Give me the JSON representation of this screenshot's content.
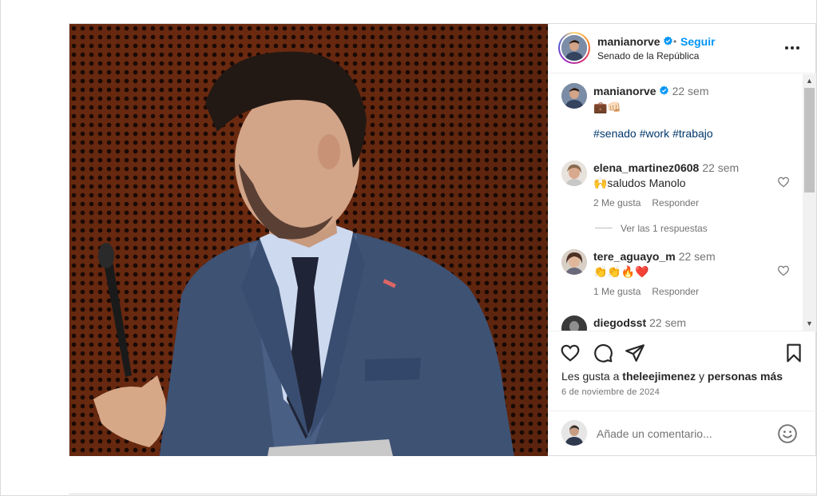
{
  "post": {
    "author": {
      "username": "manianorve",
      "verified": true,
      "follow_label": "Seguir",
      "separator": "•",
      "location": "Senado de la República"
    },
    "caption": {
      "username": "manianorve",
      "time": "22 sem",
      "emoji_line": "💼👊🏻",
      "hashtags": [
        "#senado",
        "#work",
        "#trabajo"
      ]
    },
    "comments": [
      {
        "username": "elena_martinez0608",
        "time": "22 sem",
        "text": "🙌saludos Manolo",
        "likes_label": "2 Me gusta",
        "reply_label": "Responder",
        "replies_label": "Ver las 1 respuestas"
      },
      {
        "username": "tere_aguayo_m",
        "time": "22 sem",
        "text": "👏👏🔥❤️",
        "likes_label": "1 Me gusta",
        "reply_label": "Responder"
      },
      {
        "username": "diegodsst",
        "time": "22 sem"
      }
    ],
    "likes": {
      "prefix": "Les gusta a",
      "user": "theleejimenez",
      "joiner": "y",
      "others": "personas más"
    },
    "date": "6 de noviembre de 2024",
    "add_comment": {
      "placeholder": "Añade un comentario..."
    },
    "icons": {
      "like": "heart-icon",
      "comment": "comment-icon",
      "share": "share-icon",
      "save": "bookmark-icon",
      "more": "more-icon",
      "emoji": "emoji-icon",
      "verified": "verified-badge-icon"
    },
    "colors": {
      "link": "#0095f6",
      "hashtag": "#00376b",
      "secondary_text": "#737373",
      "primary_text": "#262626",
      "verified": "#0095f6"
    }
  }
}
